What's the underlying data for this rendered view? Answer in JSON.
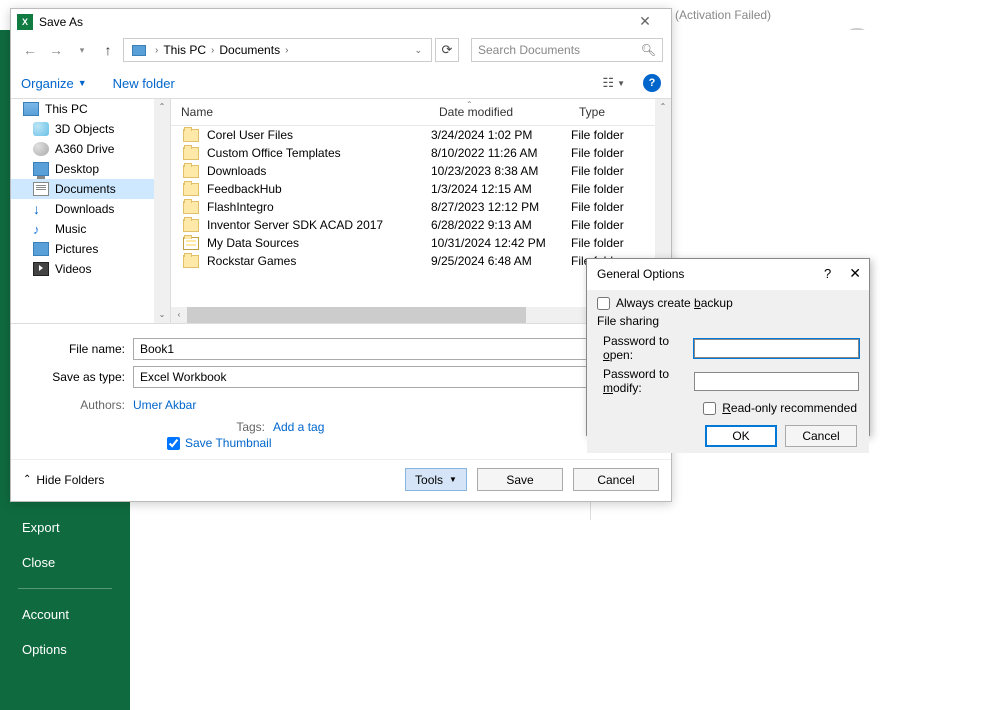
{
  "background": {
    "activation": "(Activation Failed)",
    "sidebar": {
      "export": "Export",
      "close": "Close",
      "account": "Account",
      "options": "Options"
    }
  },
  "saveAs": {
    "title": "Save As",
    "breadcrumb": {
      "root": "This PC",
      "folder": "Documents"
    },
    "searchPlaceholder": "Search Documents",
    "organize": "Organize",
    "newFolder": "New folder",
    "columns": {
      "name": "Name",
      "date": "Date modified",
      "type": "Type"
    },
    "tree": {
      "thispc": "This PC",
      "items": [
        "3D Objects",
        "A360 Drive",
        "Desktop",
        "Documents",
        "Downloads",
        "Music",
        "Pictures",
        "Videos"
      ]
    },
    "files": [
      {
        "name": "Corel User Files",
        "date": "3/24/2024 1:02 PM",
        "type": "File folder"
      },
      {
        "name": "Custom Office Templates",
        "date": "8/10/2022 11:26 AM",
        "type": "File folder"
      },
      {
        "name": "Downloads",
        "date": "10/23/2023 8:38 AM",
        "type": "File folder"
      },
      {
        "name": "FeedbackHub",
        "date": "1/3/2024 12:15 AM",
        "type": "File folder"
      },
      {
        "name": "FlashIntegro",
        "date": "8/27/2023 12:12 PM",
        "type": "File folder"
      },
      {
        "name": "Inventor Server SDK ACAD 2017",
        "date": "6/28/2022 9:13 AM",
        "type": "File folder"
      },
      {
        "name": "My Data Sources",
        "date": "10/31/2024 12:42 PM",
        "type": "File folder",
        "db": true
      },
      {
        "name": "Rockstar Games",
        "date": "9/25/2024 6:48 AM",
        "type": "File folder"
      }
    ],
    "fileNameLabel": "File name:",
    "fileNameValue": "Book1",
    "saveTypeLabel": "Save as type:",
    "saveTypeValue": "Excel Workbook",
    "authorsLabel": "Authors:",
    "authorsValue": "Umer Akbar",
    "tagsLabel": "Tags:",
    "tagsValue": "Add a tag",
    "saveThumb": "Save Thumbnail",
    "hideFolders": "Hide Folders",
    "tools": "Tools",
    "save": "Save",
    "cancel": "Cancel"
  },
  "genOpts": {
    "title": "General Options",
    "backup": "Always create backup",
    "fileSharing": "File sharing",
    "pwOpen": "Password to open:",
    "pwModify": "Password to modify:",
    "readOnly": "Read-only recommended",
    "ok": "OK",
    "cancel": "Cancel"
  }
}
